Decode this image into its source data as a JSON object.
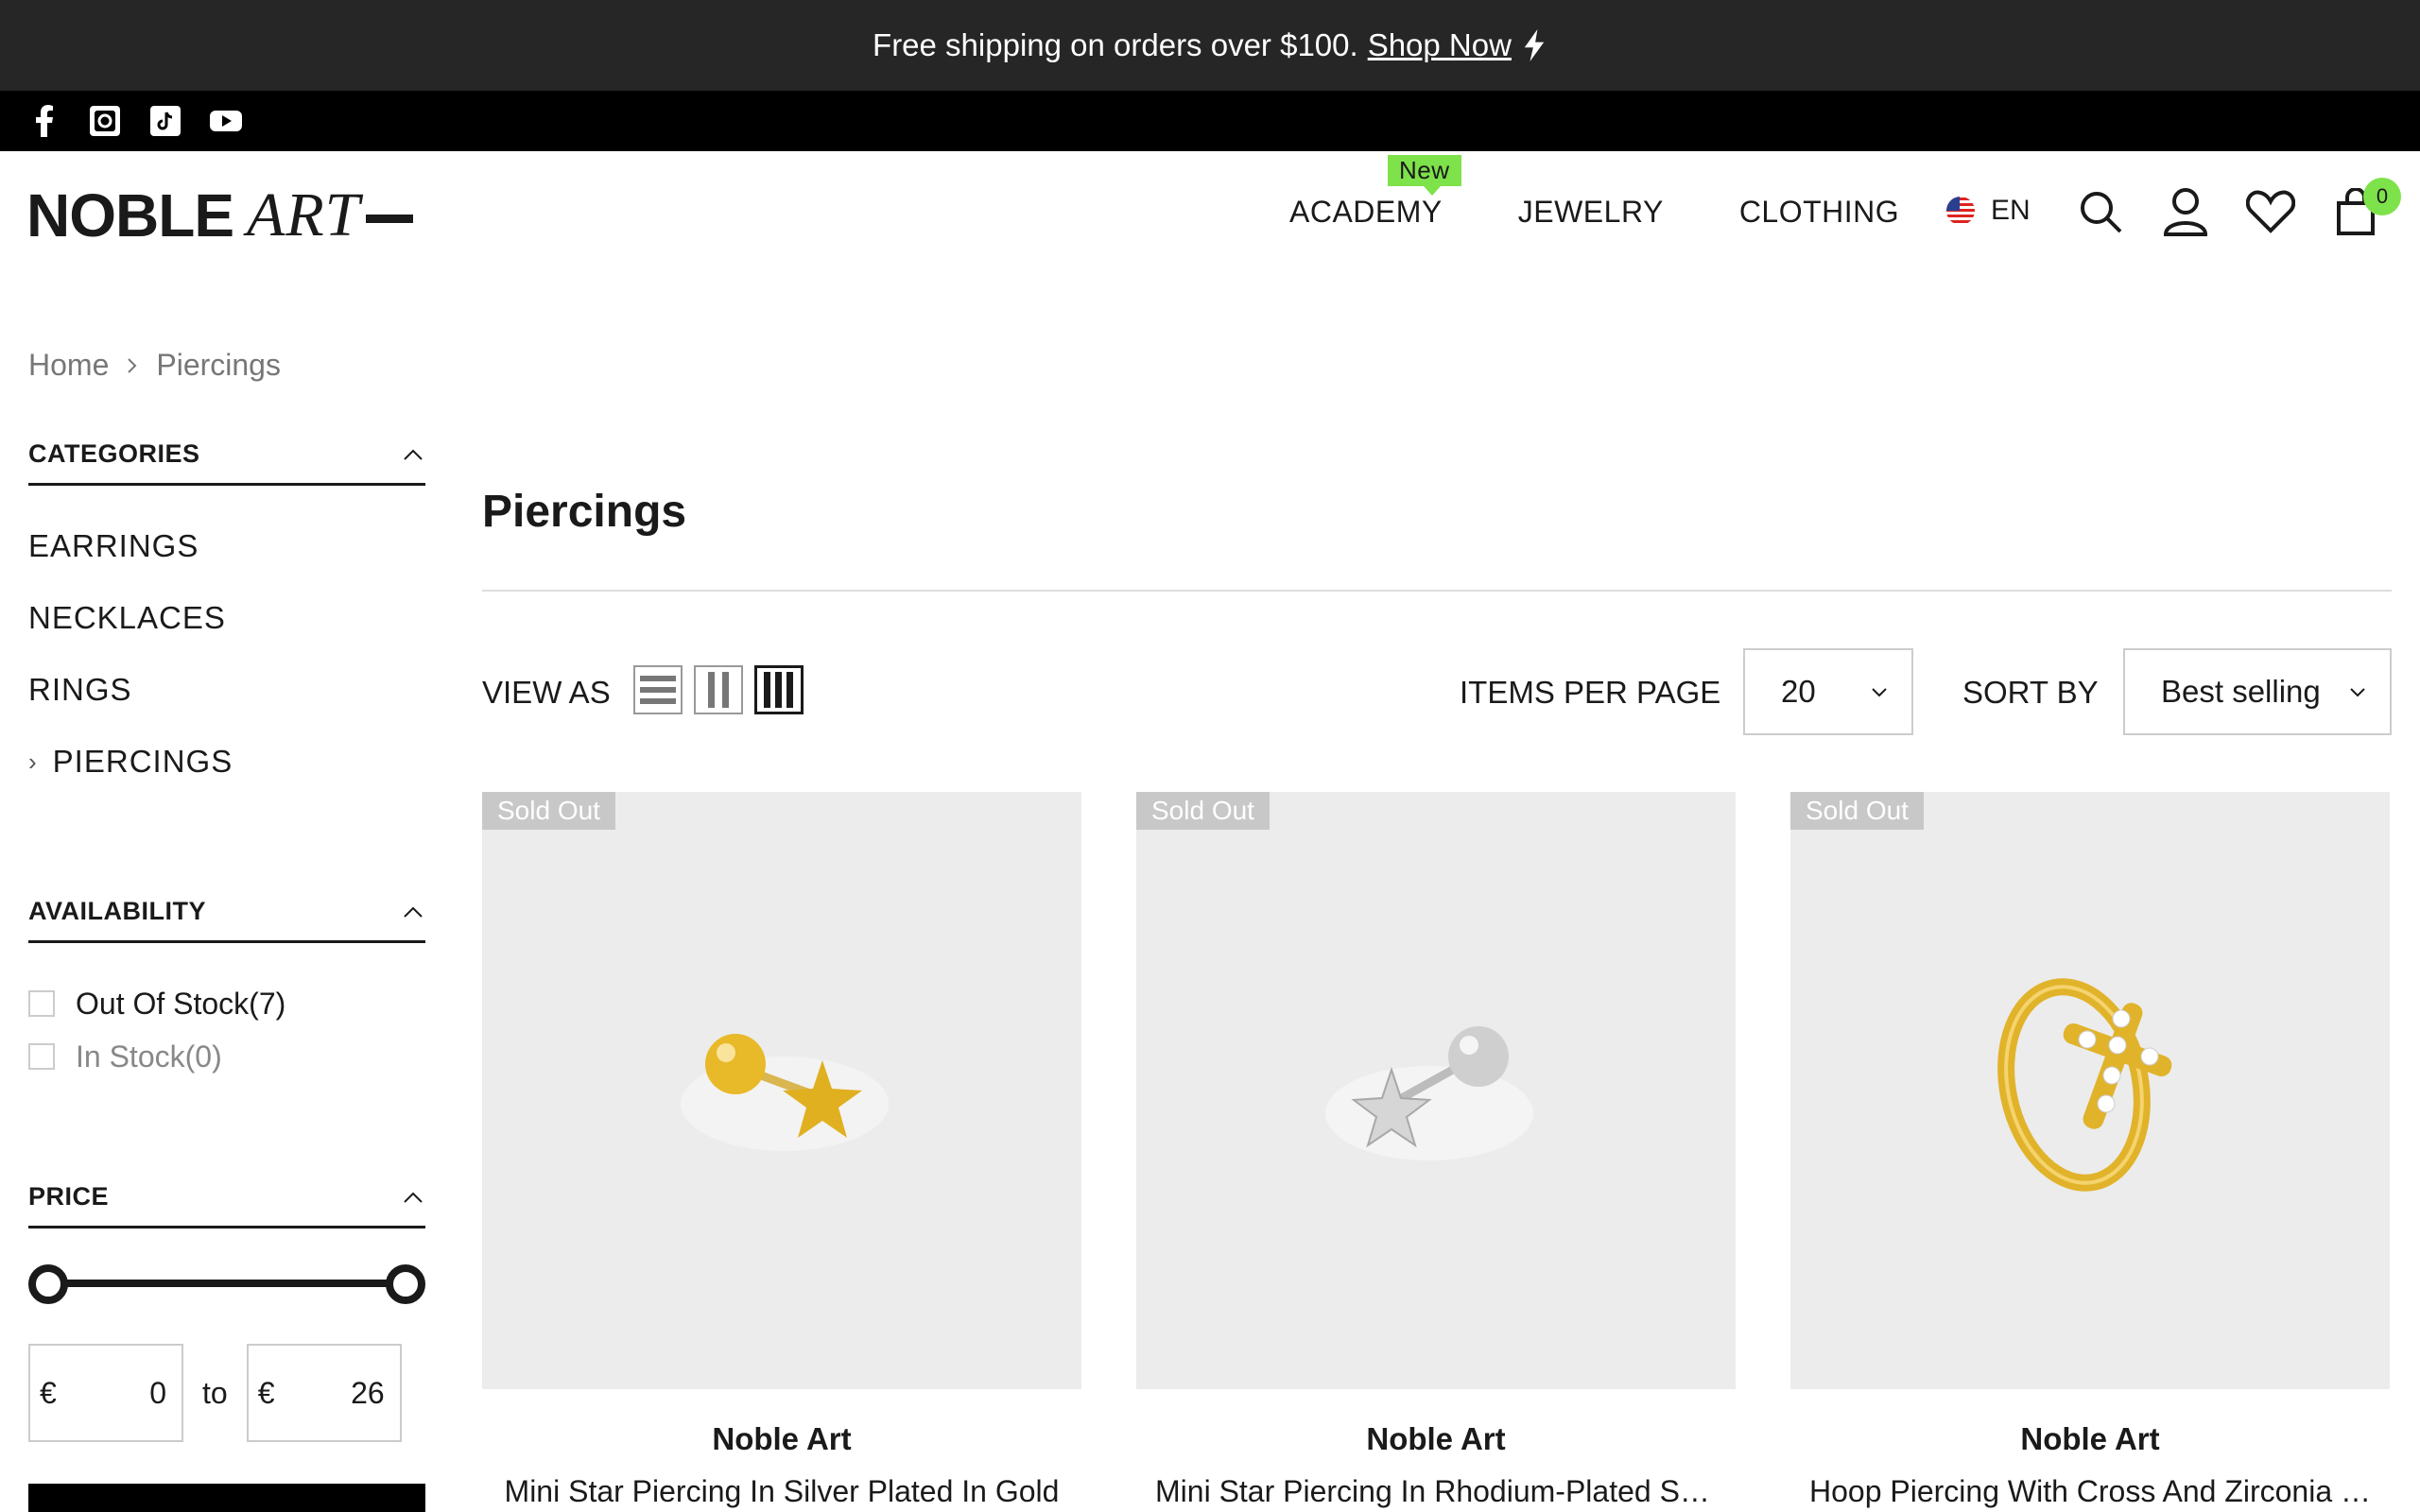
{
  "announcement": {
    "text": "Free shipping on orders over $100.",
    "link": "Shop Now"
  },
  "social": {
    "icons": [
      "facebook-icon",
      "instagram-icon",
      "tiktok-icon",
      "youtube-icon"
    ]
  },
  "header": {
    "logo_bold": "NOBLE",
    "logo_italic": "ART",
    "nav": [
      {
        "label": "ACADEMY",
        "badge": "New"
      },
      {
        "label": "JEWELRY"
      },
      {
        "label": "CLOTHING"
      }
    ],
    "language": "EN",
    "cart_count": "0",
    "badge_color": "#7ee24a"
  },
  "breadcrumb": {
    "home": "Home",
    "current": "Piercings"
  },
  "sidebar": {
    "categories": {
      "title": "CATEGORIES",
      "items": [
        "EARRINGS",
        "NECKLACES",
        "RINGS",
        "PIERCINGS"
      ]
    },
    "availability": {
      "title": "AVAILABILITY",
      "options": [
        "Out Of Stock(7)",
        "In Stock(0)"
      ]
    },
    "price": {
      "title": "PRICE",
      "currency": "€",
      "min": "0",
      "max": "26",
      "to_label": "to"
    }
  },
  "main": {
    "title": "Piercings",
    "view_as": "VIEW AS",
    "items_per_page_label": "ITEMS PER PAGE",
    "items_per_page": "20",
    "sort_by_label": "SORT BY",
    "sort_by": "Best selling"
  },
  "products": [
    {
      "badge": "Sold Out",
      "brand": "Noble Art",
      "name": "Mini Star Piercing In Silver Plated In Gold"
    },
    {
      "badge": "Sold Out",
      "brand": "Noble Art",
      "name": "Mini Star Piercing In Rhodium-Plated Silver"
    },
    {
      "badge": "Sold Out",
      "brand": "Noble Art",
      "name": "Hoop Piercing With Cross And Zirconia In Gold Plated Silver"
    }
  ]
}
